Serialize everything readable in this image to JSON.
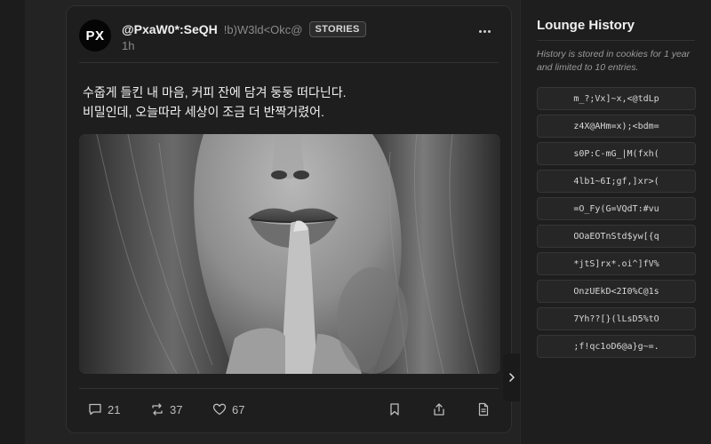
{
  "post": {
    "avatar_initials": "PX",
    "username": "@PxaW0*:SeQH",
    "handle": "!b)W3ld<Okc@",
    "badge": "STORIES",
    "time": "1h",
    "text_line1": "수줍게 들킨 내 마음, 커피 잔에 담겨 둥둥 떠다닌다.",
    "text_line2": "비밀인데, 오늘따라 세상이 조금 더 반짝거렸어.",
    "image_icon": "photo-woman-finger-on-lips",
    "actions": {
      "comments": "21",
      "reposts": "37",
      "likes": "67"
    }
  },
  "history": {
    "title": "Lounge History",
    "note": "History is stored in cookies for 1 year and limited to 10 entries.",
    "entries": [
      "m_?;Vx]~x,<@tdLp",
      "z4X@AHm=x);<bdm=",
      "s0P:C-mG_|M(fxh(",
      "4lb1~6I;gf,]xr>(",
      "=O_Fy(G=VQdT:#vu",
      "OOaEOTnStd$yw[{q",
      "*jtS]rx*.oi^]fV%",
      "OnzUEkD<2I0%C@1s",
      "7Yh??[}(lLsD5%tO",
      ";f!qc1oD6@a}g~=."
    ]
  },
  "colors": {
    "background": "#1a1a1a",
    "card": "#1e1e1e",
    "panel": "#1e1e1e",
    "text": "#e8e8e8",
    "muted": "#8a8a8a"
  }
}
